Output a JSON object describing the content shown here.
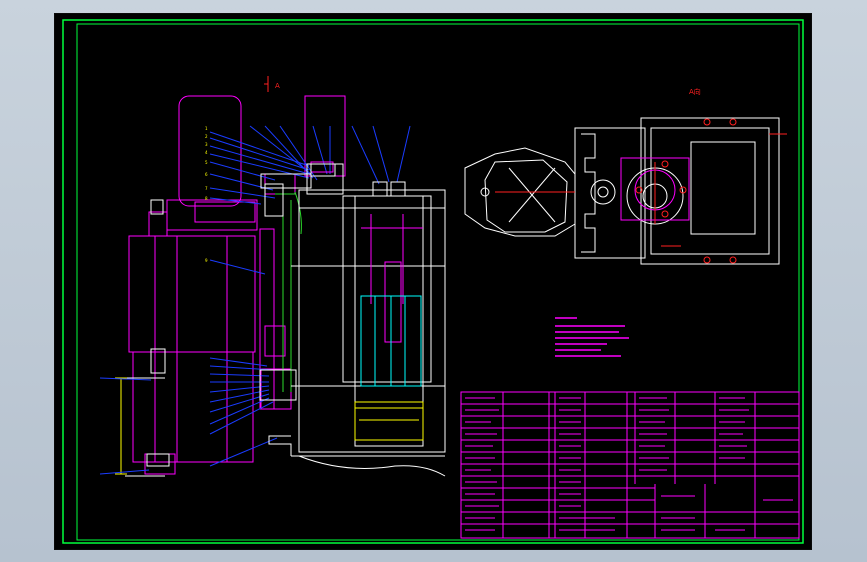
{
  "app": {
    "viewport_background": "#000000"
  },
  "colors": {
    "frame": "#00ff3c",
    "magenta": "#ff00ff",
    "blue": "#1a3cff",
    "white": "#ffffff",
    "cyan": "#00ffff",
    "yellow": "#ffff00",
    "red": "#ff2020",
    "green": "#2bdc2b"
  },
  "labels": {
    "section_mark": "A",
    "view_title": "A向"
  }
}
